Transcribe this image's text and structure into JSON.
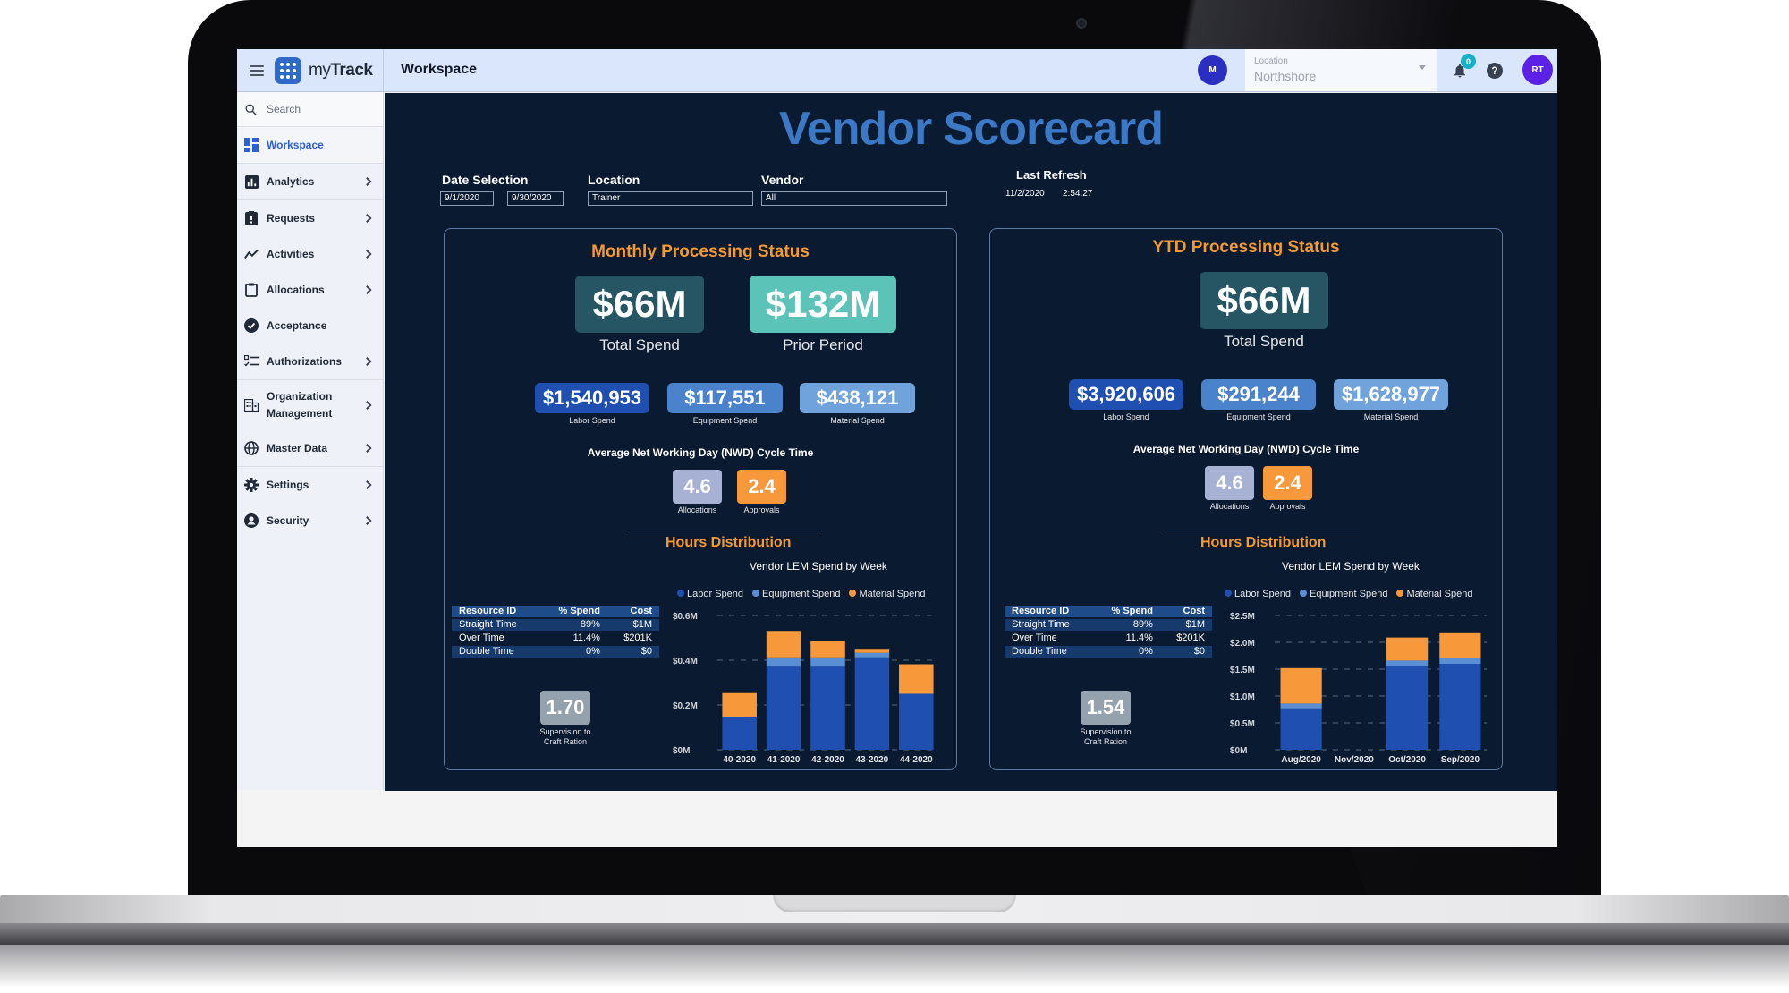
{
  "app": {
    "brand": "myTrack",
    "brand_prefix": "my",
    "brand_suffix": "Track",
    "page_title": "Workspace",
    "user_initial_left": "M",
    "location_label": "Location",
    "location_value": "Northshore",
    "notification_count": "0",
    "help_symbol": "?",
    "user_initials": "RT"
  },
  "sidebar": {
    "search_placeholder": "Search",
    "items": [
      {
        "label": "Workspace",
        "icon": "dashboard-icon",
        "active": true,
        "chevron": false
      },
      {
        "label": "Analytics",
        "icon": "analytics-icon",
        "chevron": true
      },
      {
        "label": "Requests",
        "icon": "clipboard-alert-icon",
        "chevron": true
      },
      {
        "label": "Activities",
        "icon": "trend-line-icon",
        "chevron": true
      },
      {
        "label": "Allocations",
        "icon": "clipboard-icon",
        "chevron": true
      },
      {
        "label": "Acceptance",
        "icon": "check-circle-icon",
        "chevron": false
      },
      {
        "label": "Authorizations",
        "icon": "checklist-icon",
        "chevron": true
      },
      {
        "label": "Organization",
        "label2": "Management",
        "icon": "building-icon",
        "chevron": true
      },
      {
        "label": "Master Data",
        "icon": "globe-icon",
        "chevron": true
      },
      {
        "label": "Settings",
        "icon": "gear-icon",
        "chevron": true
      },
      {
        "label": "Security",
        "icon": "user-circle-icon",
        "chevron": true
      }
    ]
  },
  "dashboard": {
    "title": "Vendor Scorecard",
    "filters": {
      "date_label": "Date Selection",
      "date_from": "9/1/2020",
      "date_to": "9/30/2020",
      "location_label": "Location",
      "location_value": "Trainer",
      "vendor_label": "Vendor",
      "vendor_value": "All",
      "refresh_label": "Last Refresh",
      "refresh_date": "11/2/2020",
      "refresh_time": "2:54:27"
    },
    "colors": {
      "labor": "#1f4fb0",
      "equipment": "#5a8fd6",
      "material": "#f7993a",
      "accent_orange": "#f39a33",
      "title_blue": "#3b79c6",
      "background": "#0a1a30"
    },
    "monthly": {
      "title": "Monthly Processing Status",
      "total_spend": "$66M",
      "total_spend_label": "Total Spend",
      "prior_period": "$132M",
      "prior_period_label": "Prior Period",
      "labor_spend": "$1,540,953",
      "labor_label": "Labor Spend",
      "equipment_spend": "$117,551",
      "equipment_label": "Equipment Spend",
      "material_spend": "$438,121",
      "material_label": "Material Spend",
      "cycle_title": "Average Net Working Day (NWD) Cycle Time",
      "allocations": "4.6",
      "allocations_label": "Allocations",
      "approvals": "2.4",
      "approvals_label": "Approvals",
      "hours_title": "Hours Distribution",
      "table": {
        "headers": [
          "Resource ID",
          "% Spend",
          "Cost"
        ],
        "rows": [
          [
            "Straight Time",
            "89%",
            "$1M"
          ],
          [
            "Over Time",
            "11.4%",
            "$201K"
          ],
          [
            "Double Time",
            "0%",
            "$0"
          ]
        ]
      },
      "ratio": "1.70",
      "ratio_label_1": "Supervision to",
      "ratio_label_2": "Craft Ration"
    },
    "ytd": {
      "title": "YTD Processing Status",
      "total_spend": "$66M",
      "total_spend_label": "Total Spend",
      "labor_spend": "$3,920,606",
      "labor_label": "Labor Spend",
      "equipment_spend": "$291,244",
      "equipment_label": "Equipment Spend",
      "material_spend": "$1,628,977",
      "material_label": "Material Spend",
      "cycle_title": "Average Net Working Day (NWD) Cycle Time",
      "allocations": "4.6",
      "allocations_label": "Allocations",
      "approvals": "2.4",
      "approvals_label": "Approvals",
      "hours_title": "Hours Distribution",
      "table": {
        "headers": [
          "Resource ID",
          "% Spend",
          "Cost"
        ],
        "rows": [
          [
            "Straight Time",
            "89%",
            "$1M"
          ],
          [
            "Over Time",
            "11.4%",
            "$201K"
          ],
          [
            "Double Time",
            "0%",
            "$0"
          ]
        ]
      },
      "ratio": "1.54",
      "ratio_label_1": "Supervision to",
      "ratio_label_2": "Craft Ration"
    }
  },
  "chart_data": [
    {
      "type": "bar",
      "stacked": true,
      "title": "Vendor LEM Spend by Week",
      "categories": [
        "40-2020",
        "41-2020",
        "42-2020",
        "43-2020",
        "44-2020"
      ],
      "series": [
        {
          "name": "Labor Spend",
          "values": [
            0.144,
            0.371,
            0.371,
            0.413,
            0.25
          ]
        },
        {
          "name": "Equipment Spend",
          "values": [
            0.0,
            0.042,
            0.042,
            0.02,
            0.0
          ]
        },
        {
          "name": "Material Spend",
          "values": [
            0.109,
            0.118,
            0.073,
            0.014,
            0.132
          ]
        }
      ],
      "xlabel": "",
      "ylabel": "",
      "ylim": [
        0,
        0.6
      ],
      "yticks": [
        0,
        0.2,
        0.4,
        0.6
      ],
      "ytick_labels": [
        "$0M",
        "$0.2M",
        "$0.4M",
        "$0.6M"
      ],
      "grid": true,
      "legend_position": "top"
    },
    {
      "type": "bar",
      "stacked": true,
      "title": "Vendor LEM Spend by Week",
      "categories": [
        "Aug/2020",
        "Nov/2020",
        "Oct/2020",
        "Sep/2020"
      ],
      "series": [
        {
          "name": "Labor Spend",
          "values": [
            0.77,
            0.0,
            1.56,
            1.6
          ]
        },
        {
          "name": "Equipment Spend",
          "values": [
            0.09,
            0.0,
            0.1,
            0.1
          ]
        },
        {
          "name": "Material Spend",
          "values": [
            0.66,
            0.0,
            0.43,
            0.47
          ]
        }
      ],
      "xlabel": "",
      "ylabel": "",
      "ylim": [
        0,
        2.5
      ],
      "yticks": [
        0,
        0.5,
        1.0,
        1.5,
        2.0,
        2.5
      ],
      "ytick_labels": [
        "$0M",
        "$0.5M",
        "$1.0M",
        "$1.5M",
        "$2.0M",
        "$2.5M"
      ],
      "grid": true,
      "legend_position": "top"
    }
  ]
}
